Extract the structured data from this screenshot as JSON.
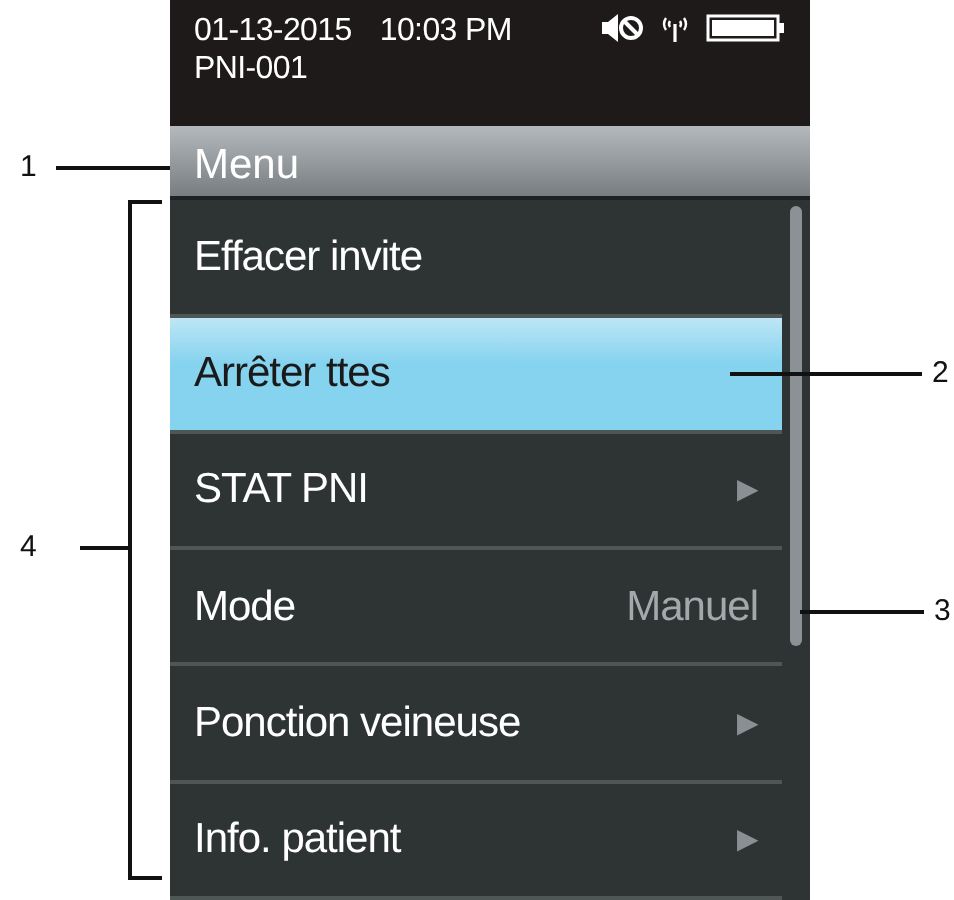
{
  "status_bar": {
    "date": "01-13-2015",
    "time": "10:03 PM",
    "patient_id": "PNI-001"
  },
  "menu": {
    "title": "Menu",
    "items": [
      {
        "kind": "action",
        "label": "Effacer invite",
        "selected": false
      },
      {
        "kind": "action",
        "label": "Arrêter ttes",
        "selected": true
      },
      {
        "kind": "submenu",
        "label": "STAT PNI",
        "arrow": "▶",
        "selected": false
      },
      {
        "kind": "value",
        "label": "Mode",
        "value": "Manuel",
        "selected": false
      },
      {
        "kind": "submenu",
        "label": "Ponction veineuse",
        "arrow": "▶",
        "selected": false
      },
      {
        "kind": "submenu",
        "label": "Info. patient",
        "arrow": "▶",
        "selected": false
      }
    ]
  },
  "callouts": [
    {
      "label": "1"
    },
    {
      "label": "2"
    },
    {
      "label": "3"
    },
    {
      "label": "4"
    }
  ]
}
